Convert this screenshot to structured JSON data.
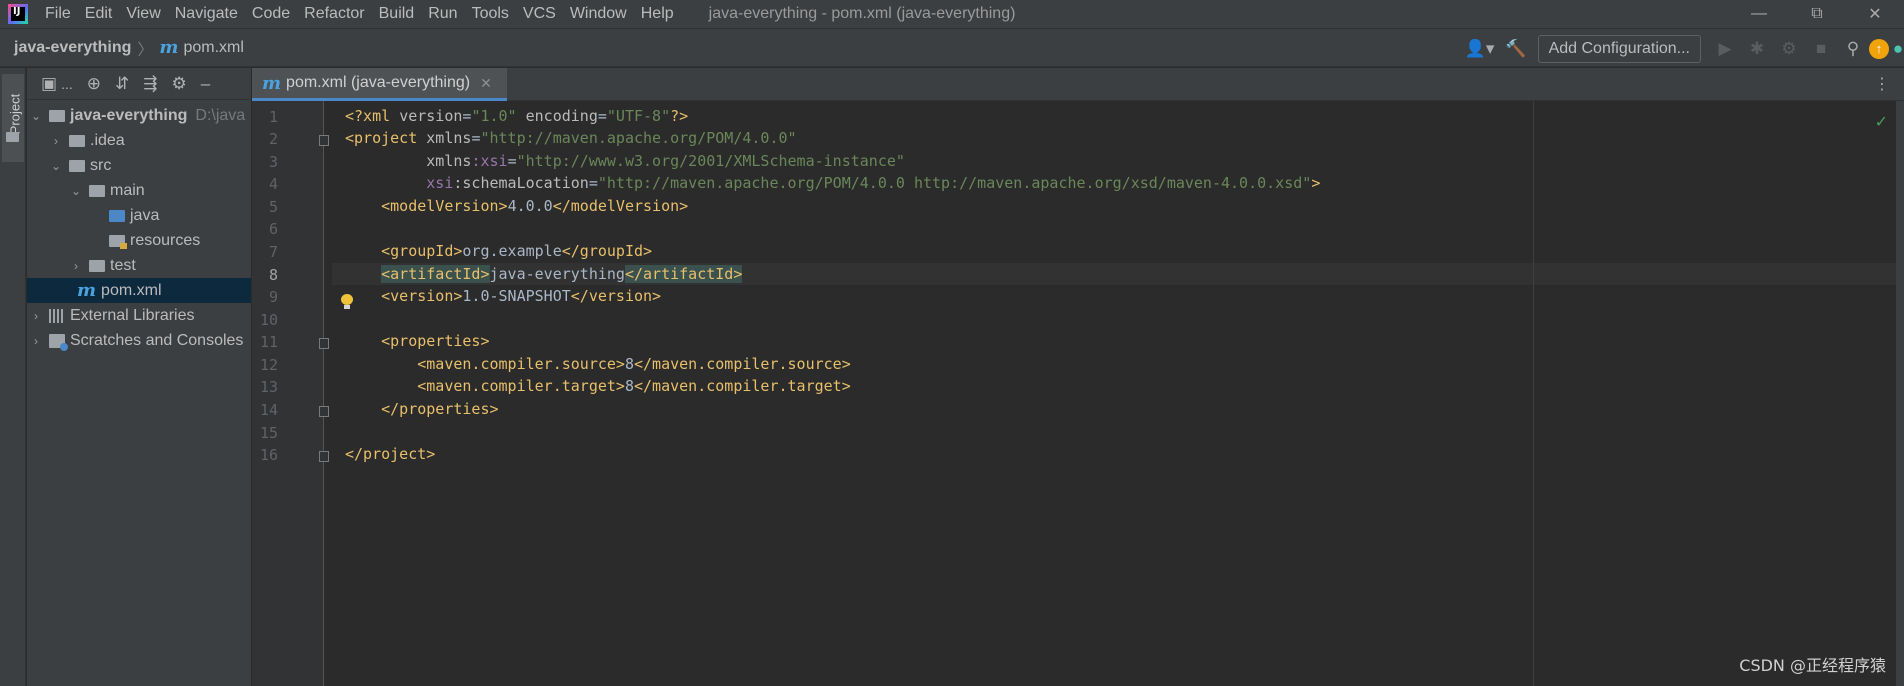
{
  "menu": [
    "File",
    "Edit",
    "View",
    "Navigate",
    "Code",
    "Refactor",
    "Build",
    "Run",
    "Tools",
    "VCS",
    "Window",
    "Help"
  ],
  "window_title": "java-everything - pom.xml (java-everything)",
  "breadcrumb": {
    "project": "java-everything",
    "file": "pom.xml"
  },
  "toolbar": {
    "add_configuration": "Add Configuration..."
  },
  "left_strip": {
    "project_label": "Project"
  },
  "project_panel": {
    "toolbar_more": "...",
    "tree": {
      "root": {
        "name": "java-everything",
        "path": "D:\\java"
      },
      "idea": ".idea",
      "src": "src",
      "main": "main",
      "java": "java",
      "resources": "resources",
      "test": "test",
      "pom": "pom.xml",
      "external_libraries": "External Libraries",
      "scratches": "Scratches and Consoles"
    }
  },
  "editor": {
    "tab_label": "pom.xml (java-everything)",
    "current_line": 8,
    "line_numbers": [
      "1",
      "2",
      "3",
      "4",
      "5",
      "6",
      "7",
      "8",
      "9",
      "10",
      "11",
      "12",
      "13",
      "14",
      "15",
      "16"
    ],
    "code": {
      "l1": {
        "a": "<?xml ",
        "b": "version",
        "c": "=",
        "d": "\"1.0\"",
        "e": " ",
        "f": "encoding",
        "g": "=",
        "h": "\"UTF-8\"",
        "i": "?>"
      },
      "l2": {
        "a": "<project ",
        "b": "xmlns",
        "c": "=",
        "d": "\"http://maven.apache.org/POM/4.0.0\""
      },
      "l3": {
        "a": "         xmlns",
        "b": ":xsi",
        "c": "=",
        "d": "\"http://www.w3.org/2001/XMLSchema-instance\""
      },
      "l4": {
        "a": "         xsi",
        "b": ":schemaLocation",
        "c": "=",
        "d": "\"http://maven.apache.org/POM/4.0.0 http://maven.apache.org/xsd/maven-4.0.0.xsd\"",
        "e": ">"
      },
      "l5": {
        "a": "    <modelVersion>",
        "b": "4.0.0",
        "c": "</modelVersion>"
      },
      "l7": {
        "a": "    <groupId>",
        "b": "org.example",
        "c": "</groupId>"
      },
      "l8": {
        "indent": "    ",
        "a": "<artifactId>",
        "b": "java-everything",
        "c": "</artifactId>"
      },
      "l9": {
        "a": "    <version>",
        "b": "1.0-SNAPSHOT",
        "c": "</version>"
      },
      "l11": {
        "a": "    <properties>"
      },
      "l12": {
        "a": "        <maven.compiler.source>",
        "b": "8",
        "c": "</maven.compiler.source>"
      },
      "l13": {
        "a": "        <maven.compiler.target>",
        "b": "8",
        "c": "</maven.compiler.target>"
      },
      "l14": {
        "a": "    </properties>"
      },
      "l16": {
        "a": "</project>"
      }
    }
  },
  "watermark": "CSDN @正经程序猿",
  "colors": {
    "tag": "#e8bf6a",
    "string": "#6a8759",
    "namespace": "#9876aa",
    "text": "#a9b7c6",
    "selection": "#0d293e",
    "accent": "#4a88c7"
  }
}
